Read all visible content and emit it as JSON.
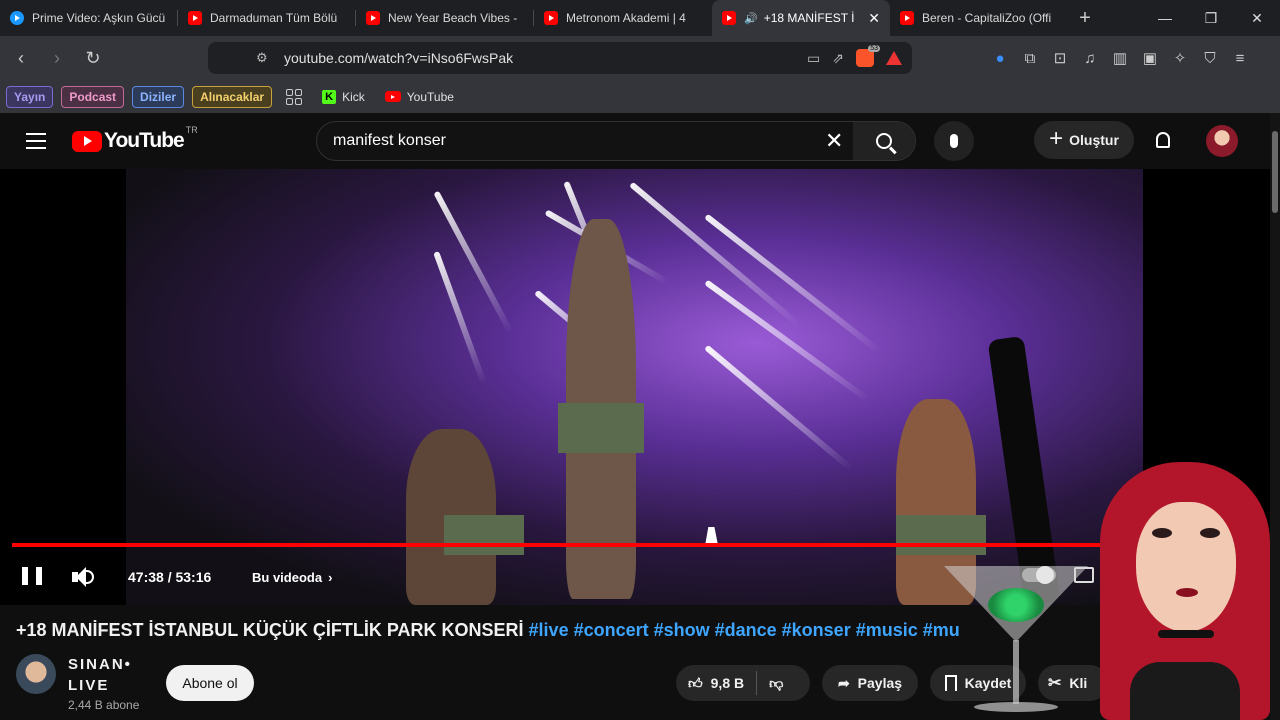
{
  "browser": {
    "tabs": [
      {
        "title": "Prime Video: Aşkın Gücü",
        "icon": "prime-video-icon"
      },
      {
        "title": "Darmaduman Tüm Bölü",
        "icon": "youtube-icon"
      },
      {
        "title": "New Year Beach Vibes -",
        "icon": "youtube-icon"
      },
      {
        "title": "Metronom Akademi | 4",
        "icon": "youtube-icon"
      },
      {
        "title": "+18 MANİFEST İ",
        "icon": "youtube-icon",
        "active": true,
        "audio": true
      },
      {
        "title": "Beren - CapitaliZoo (Offi",
        "icon": "youtube-icon"
      }
    ],
    "url": "youtube.com/watch?v=iNso6FwsPak",
    "brave_shield_count": "53",
    "bookmarks": {
      "folders": [
        "Yayın",
        "Podcast",
        "Diziler",
        "Alınacaklar"
      ],
      "links": [
        "Kick",
        "YouTube"
      ]
    }
  },
  "youtube": {
    "logo_text": "YouTube",
    "region": "TR",
    "search_query": "manifest konser",
    "create_label": "Oluştur"
  },
  "player": {
    "time_current": "47:38",
    "time_total": "53:16",
    "time_display": "47:38 / 53:16",
    "progress_fraction": 0.894,
    "chapter_label": "Bu videoda"
  },
  "video": {
    "title_main": "+18 MANİFEST İSTANBUL KÜÇÜK ÇİFTLİK PARK KONSERİ",
    "title_tags": "#live #concert #show #dance #konser #music #mu",
    "channel_name_line1": "SINAN•",
    "channel_name_line2": "LIVE",
    "subscribers": "2,44 B abone",
    "subscribe_label": "Abone ol",
    "likes": "9,8 B",
    "share_label": "Paylaş",
    "save_label": "Kaydet",
    "clip_label": "Kli"
  },
  "colors": {
    "accent_red": "#ff0000",
    "hashtag_blue": "#3ea6ff"
  }
}
